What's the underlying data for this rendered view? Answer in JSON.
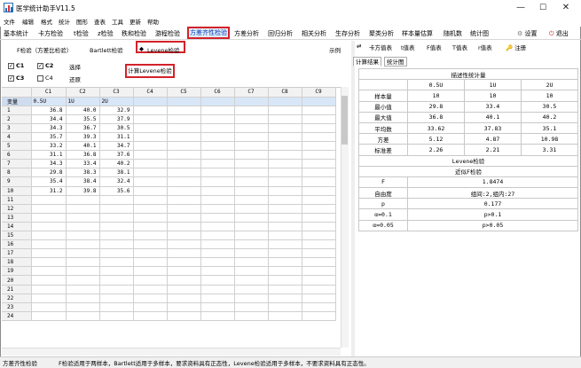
{
  "window": {
    "title": "医学统计助手V11.5",
    "minimize": "—",
    "maximize": "☐",
    "close": "✕"
  },
  "menu": [
    "文件",
    "编辑",
    "格式",
    "统计",
    "图形",
    "查表",
    "工具",
    "更新",
    "帮助"
  ],
  "toolbar": {
    "tabs": [
      "基本统计",
      "卡方检验",
      "t检验",
      "z检验",
      "秩和检验",
      "游程检验",
      "方差齐性检验",
      "方差分析",
      "回归分析",
      "相关分析",
      "生存分析",
      "聚类分析",
      "样本量估算",
      "随机数",
      "统计图"
    ],
    "active_tab": "方差齐性检验",
    "settings_label": "设置",
    "exit_label": "退出"
  },
  "test_options": {
    "f_test": "F检验（方差比检验）",
    "bartlett": "Bartlett检验",
    "levene": "Levene检验",
    "example": "示例"
  },
  "column_select": {
    "c1": "C1",
    "c2": "C2",
    "c3": "C3",
    "c4": "C4",
    "select": "选择",
    "restore": "还原",
    "c1_checked": true,
    "c2_checked": true,
    "c3_checked": true,
    "c4_checked": false
  },
  "calc_button": "计算Levene检验",
  "grid": {
    "columns": [
      "C1",
      "C2",
      "C3",
      "C4",
      "C5",
      "C6",
      "C7",
      "C8",
      "C9"
    ],
    "var_row_label": "变量",
    "var_names": [
      "0.5U",
      "1U",
      "2U",
      "",
      "",
      "",
      "",
      "",
      ""
    ],
    "rows": [
      [
        "1",
        "36.8",
        "40.0",
        "32.9"
      ],
      [
        "2",
        "34.4",
        "35.5",
        "37.9"
      ],
      [
        "3",
        "34.3",
        "36.7",
        "30.5"
      ],
      [
        "4",
        "35.7",
        "39.3",
        "31.1"
      ],
      [
        "5",
        "33.2",
        "40.1",
        "34.7"
      ],
      [
        "6",
        "31.1",
        "36.8",
        "37.6"
      ],
      [
        "7",
        "34.3",
        "33.4",
        "40.2"
      ],
      [
        "8",
        "29.8",
        "38.3",
        "38.1"
      ],
      [
        "9",
        "35.4",
        "38.4",
        "32.4"
      ],
      [
        "10",
        "31.2",
        "39.8",
        "35.6"
      ],
      [
        "11",
        "",
        "",
        ""
      ],
      [
        "12",
        "",
        "",
        ""
      ],
      [
        "13",
        "",
        "",
        ""
      ],
      [
        "14",
        "",
        "",
        ""
      ],
      [
        "15",
        "",
        "",
        ""
      ],
      [
        "16",
        "",
        "",
        ""
      ],
      [
        "17",
        "",
        "",
        ""
      ],
      [
        "18",
        "",
        "",
        ""
      ],
      [
        "19",
        "",
        "",
        ""
      ],
      [
        "20",
        "",
        "",
        ""
      ],
      [
        "21",
        "",
        "",
        ""
      ],
      [
        "22",
        "",
        "",
        ""
      ],
      [
        "23",
        "",
        "",
        ""
      ],
      [
        "24",
        "",
        "",
        ""
      ]
    ]
  },
  "right_toolbar": {
    "chi_table": "卡方值表",
    "t_table": "t值表",
    "f_table": "F值表",
    "T_table": "T值表",
    "r_table": "r值表",
    "register": "注册"
  },
  "result_tabs": [
    "计算结果",
    "统计图"
  ],
  "results": {
    "desc_title": "描述性统计量",
    "groups": [
      "0.5U",
      "1U",
      "2U"
    ],
    "stats": [
      {
        "label": "样本量",
        "values": [
          "10",
          "10",
          "10"
        ]
      },
      {
        "label": "最小值",
        "values": [
          "29.8",
          "33.4",
          "30.5"
        ]
      },
      {
        "label": "最大值",
        "values": [
          "36.8",
          "40.1",
          "40.2"
        ]
      },
      {
        "label": "平均数",
        "values": [
          "33.62",
          "37.83",
          "35.1"
        ]
      },
      {
        "label": "方差",
        "values": [
          "5.12",
          "4.87",
          "10.98"
        ]
      },
      {
        "label": "标准差",
        "values": [
          "2.26",
          "2.21",
          "3.31"
        ]
      }
    ],
    "levene_title": "Levene检验",
    "approx_title": "近似F检验",
    "f_label": "F",
    "f_value": "1.8474",
    "df_label": "自由度",
    "df_value": "组间:2,组内:27",
    "p_label": "p",
    "p_value": "0.177",
    "a01_label": "α=0.1",
    "a01_value": "p>0.1",
    "a005_label": "α=0.05",
    "a005_value": "p>0.05"
  },
  "status": {
    "left": "方差齐性检验",
    "message": "F检验适用于两样本，Bartlett适用于多样本，要求资料具有正态性，Levene检验适用于多样本，不要求资料具有正态性。"
  }
}
